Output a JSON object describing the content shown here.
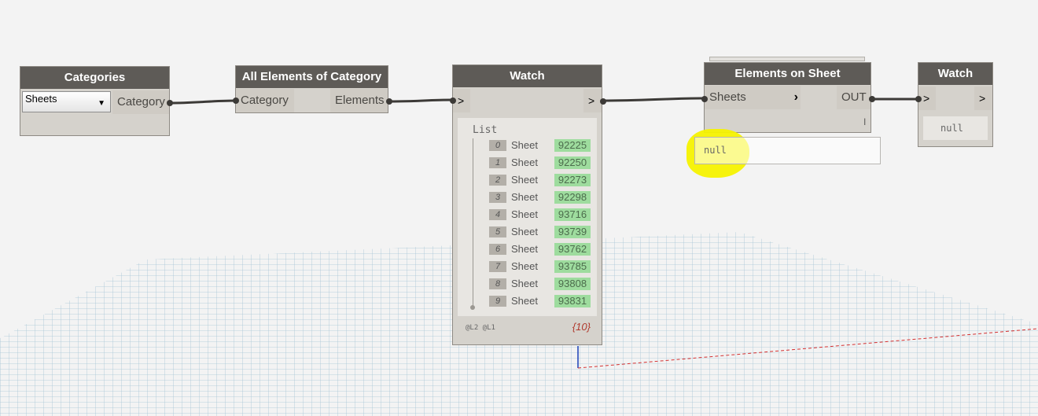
{
  "nodes": {
    "categories": {
      "title": "Categories",
      "dropdown_value": "Sheets",
      "output_label": "Category"
    },
    "all_elements": {
      "title": "All Elements of Category",
      "input_label": "Category",
      "output_label": "Elements"
    },
    "watch1": {
      "title": "Watch",
      "in_label": ">",
      "out_label": ">",
      "list_label": "List",
      "items": [
        {
          "index": "0",
          "label": "Sheet",
          "value": "92225"
        },
        {
          "index": "1",
          "label": "Sheet",
          "value": "92250"
        },
        {
          "index": "2",
          "label": "Sheet",
          "value": "92273"
        },
        {
          "index": "3",
          "label": "Sheet",
          "value": "92298"
        },
        {
          "index": "4",
          "label": "Sheet",
          "value": "93716"
        },
        {
          "index": "5",
          "label": "Sheet",
          "value": "93739"
        },
        {
          "index": "6",
          "label": "Sheet",
          "value": "93762"
        },
        {
          "index": "7",
          "label": "Sheet",
          "value": "93785"
        },
        {
          "index": "8",
          "label": "Sheet",
          "value": "93808"
        },
        {
          "index": "9",
          "label": "Sheet",
          "value": "93831"
        }
      ],
      "levels": "@L2 @L1",
      "count": "{10}"
    },
    "elements_on_sheet": {
      "title": "Elements on Sheet",
      "input_label": "Sheets",
      "output_label": "OUT",
      "lacing": "l",
      "preview": "null"
    },
    "watch2": {
      "title": "Watch",
      "in_label": ">",
      "out_label": ">",
      "value": "null"
    }
  },
  "colors": {
    "header": "#5e5b57",
    "node_body": "#d5d2cc",
    "highlight": "#f6f200",
    "value_green": "#9edc9e",
    "wire": "#3c3a37"
  }
}
